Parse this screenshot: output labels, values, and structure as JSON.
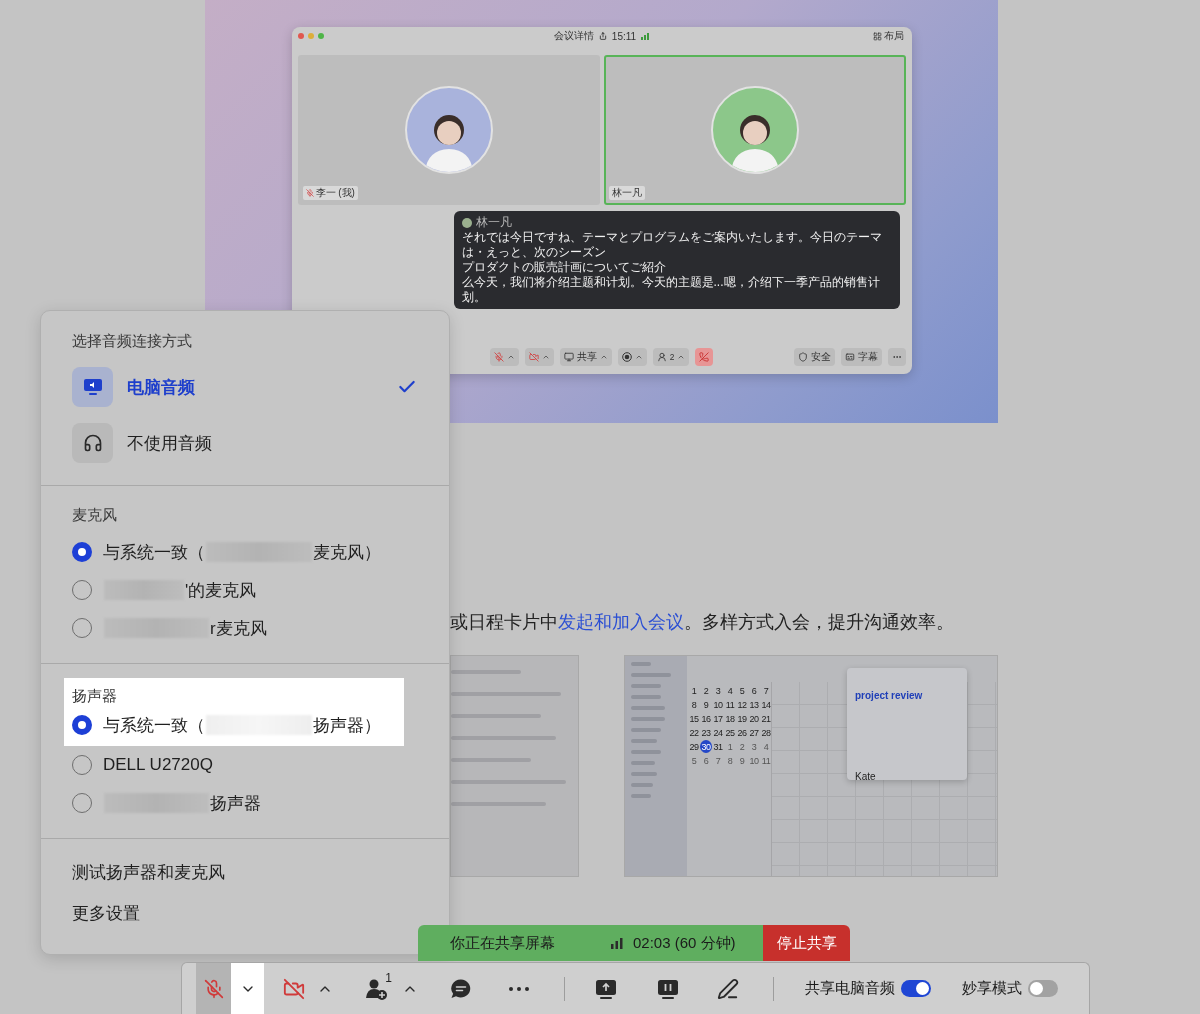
{
  "meeting_preview": {
    "title": "会议详情",
    "time": "15:11",
    "layout_label": "布局",
    "tiles": [
      {
        "name": "李一 (我)",
        "muted": true,
        "active": false,
        "color": "#a9b3dc"
      },
      {
        "name": "林一凡",
        "muted": false,
        "active": true,
        "color": "#8cc78a"
      }
    ],
    "caption": {
      "speaker": "林一凡",
      "lines": [
        "それでは今日ですね、テーマとプログラムをご案内いたします。今日のテーマは・えっと、次のシーズン",
        "プロダクトの販売計画についてご紹介",
        "么今天，我们将介绍主题和计划。今天的主题是...嗯，介绍下一季产品的销售计划。"
      ]
    },
    "toolbar": [
      {
        "kind": "mic",
        "muted": true
      },
      {
        "kind": "camera",
        "muted": true
      },
      {
        "kind": "share",
        "label": "共享"
      },
      {
        "kind": "record"
      },
      {
        "kind": "participants",
        "count": "2"
      },
      {
        "kind": "leave"
      }
    ],
    "toolbar_right": [
      {
        "kind": "security",
        "label": "安全"
      },
      {
        "kind": "captions",
        "label": "字幕"
      },
      {
        "kind": "more"
      }
    ]
  },
  "article": {
    "paragraph": {
      "before": "或日程卡片中",
      "link": "发起和加入会议",
      "after": "。多样方式入会，提升沟通效率。"
    },
    "calendar_screenshot": {
      "event_title": "project review",
      "attendee": "Kate",
      "dates": [
        {
          "day": "1",
          "selected": false,
          "outside": false
        },
        {
          "day": "2",
          "selected": false,
          "outside": false
        },
        {
          "day": "3",
          "selected": false,
          "outside": false
        },
        {
          "day": "4",
          "selected": false,
          "outside": false
        },
        {
          "day": "5",
          "selected": false,
          "outside": false
        },
        {
          "day": "6",
          "selected": false,
          "outside": false
        },
        {
          "day": "7",
          "selected": false,
          "outside": false
        },
        {
          "day": "8",
          "selected": false,
          "outside": false
        },
        {
          "day": "9",
          "selected": false,
          "outside": false
        },
        {
          "day": "10",
          "selected": false,
          "outside": false
        },
        {
          "day": "11",
          "selected": false,
          "outside": false
        },
        {
          "day": "12",
          "selected": false,
          "outside": false
        },
        {
          "day": "13",
          "selected": false,
          "outside": false
        },
        {
          "day": "14",
          "selected": false,
          "outside": false
        },
        {
          "day": "15",
          "selected": false,
          "outside": false
        },
        {
          "day": "16",
          "selected": false,
          "outside": false
        },
        {
          "day": "17",
          "selected": false,
          "outside": false
        },
        {
          "day": "18",
          "selected": false,
          "outside": false
        },
        {
          "day": "19",
          "selected": false,
          "outside": false
        },
        {
          "day": "20",
          "selected": false,
          "outside": false
        },
        {
          "day": "21",
          "selected": false,
          "outside": false
        },
        {
          "day": "22",
          "selected": false,
          "outside": false
        },
        {
          "day": "23",
          "selected": false,
          "outside": false
        },
        {
          "day": "24",
          "selected": false,
          "outside": false
        },
        {
          "day": "25",
          "selected": false,
          "outside": false
        },
        {
          "day": "26",
          "selected": false,
          "outside": false
        },
        {
          "day": "27",
          "selected": false,
          "outside": false
        },
        {
          "day": "28",
          "selected": false,
          "outside": false
        },
        {
          "day": "29",
          "selected": false,
          "outside": false
        },
        {
          "day": "30",
          "selected": true,
          "outside": false
        },
        {
          "day": "31",
          "selected": false,
          "outside": false
        },
        {
          "day": "1",
          "selected": false,
          "outside": true
        },
        {
          "day": "2",
          "selected": false,
          "outside": true
        },
        {
          "day": "3",
          "selected": false,
          "outside": true
        },
        {
          "day": "4",
          "selected": false,
          "outside": true
        },
        {
          "day": "5",
          "selected": false,
          "outside": true
        },
        {
          "day": "6",
          "selected": false,
          "outside": true
        },
        {
          "day": "7",
          "selected": false,
          "outside": true
        },
        {
          "day": "8",
          "selected": false,
          "outside": true
        },
        {
          "day": "9",
          "selected": false,
          "outside": true
        },
        {
          "day": "10",
          "selected": false,
          "outside": true
        },
        {
          "day": "11",
          "selected": false,
          "outside": true
        }
      ]
    }
  },
  "audio_menu": {
    "sections": [
      {
        "kind": "connection",
        "title": "选择音频连接方式",
        "options": [
          {
            "kind": "computer",
            "label": "电脑音频",
            "selected": true
          },
          {
            "kind": "none",
            "label": "不使用音频",
            "selected": false
          }
        ]
      },
      {
        "kind": "devices",
        "title": "麦克风",
        "highlighted": false,
        "options": [
          {
            "before": "与系统一致（",
            "redacted": true,
            "after": "麦克风）",
            "selected": true,
            "highlighted": false
          },
          {
            "redacted": true,
            "after": "'的麦克风",
            "selected": false,
            "highlighted": false
          },
          {
            "redacted": true,
            "after": "r麦克风",
            "selected": false,
            "highlighted": false
          }
        ]
      },
      {
        "kind": "devices",
        "title": "扬声器",
        "highlighted": true,
        "options": [
          {
            "before": "与系统一致（",
            "redacted": true,
            "after": "扬声器）",
            "selected": true,
            "highlighted": true
          },
          {
            "redacted": false,
            "after": "DELL U2720Q",
            "selected": false,
            "highlighted": false
          },
          {
            "redacted": true,
            "after": "扬声器",
            "selected": false,
            "highlighted": false
          }
        ]
      },
      {
        "kind": "actions",
        "items": [
          "测试扬声器和麦克风",
          "更多设置"
        ]
      }
    ]
  },
  "share_bar": {
    "status": "你正在共享屏幕",
    "timer": "02:03 (60 分钟)",
    "stop_label": "停止共享"
  },
  "bottom_toolbar": {
    "items": [
      {
        "kind": "mic",
        "muted": true
      },
      {
        "kind": "caret",
        "expanded": true
      },
      {
        "kind": "camera",
        "muted": true
      },
      {
        "kind": "caret",
        "expanded": false
      },
      {
        "kind": "participants",
        "count": "1"
      },
      {
        "kind": "caret",
        "expanded": false
      },
      {
        "kind": "chat"
      },
      {
        "kind": "more"
      },
      {
        "kind": "divider"
      },
      {
        "kind": "share"
      },
      {
        "kind": "whiteboard"
      },
      {
        "kind": "annotate"
      },
      {
        "kind": "divider"
      }
    ],
    "toggles": [
      {
        "label": "共享电脑音频",
        "on": true
      },
      {
        "label": "妙享模式",
        "on": false
      }
    ]
  }
}
